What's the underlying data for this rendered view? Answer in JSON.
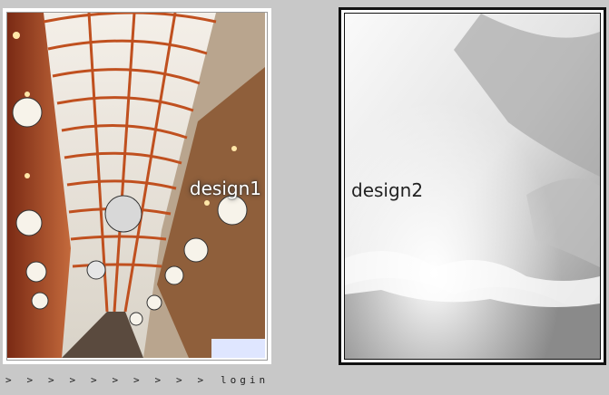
{
  "cards": [
    {
      "label": "design1"
    },
    {
      "label": "design2"
    }
  ],
  "nav": {
    "arrows": [
      ">",
      ">",
      ">",
      ">",
      ">",
      ">",
      ">",
      ">",
      ">",
      ">"
    ],
    "login": "login"
  }
}
